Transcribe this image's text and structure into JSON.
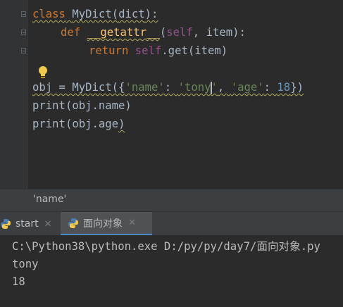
{
  "editor": {
    "lines": [
      {
        "kw": "class",
        "name": "MyDict",
        "p1": "(",
        "base": "dict",
        "p2": "):"
      },
      {
        "kw": "def",
        "fn": "__getattr__",
        "p1": "(",
        "self": "self",
        "rest": ", item):"
      },
      {
        "kw": "return",
        "self": "self",
        "rest": ".get(item)"
      },
      {
        "a": "obj = MyDict({",
        "s1": "'name'",
        "b": ": ",
        "s2a": "'tony",
        "s2b": "'",
        "c": ", ",
        "s3": "'age'",
        "d": ": ",
        "n": "18",
        "e": "})"
      },
      {
        "a": "print(obj.name)"
      },
      {
        "a": "print(obj.age",
        "b": ")"
      }
    ],
    "intention_icon": "lightbulb-icon"
  },
  "tooltip": {
    "text": "'name'"
  },
  "run_tabs": [
    {
      "label": "start",
      "icon": "python-icon"
    },
    {
      "label": "面向对象",
      "icon": "python-icon"
    }
  ],
  "close_glyph": "✕",
  "console": {
    "lines": [
      "C:\\Python38\\python.exe D:/py/py/day7/面向对象.py",
      "tony",
      "18"
    ]
  },
  "colors": {
    "accent": "#4a88c7",
    "keyword": "#cc7832",
    "function": "#ffc66d",
    "string": "#6a8759",
    "number": "#6897bb",
    "self": "#94558d"
  }
}
